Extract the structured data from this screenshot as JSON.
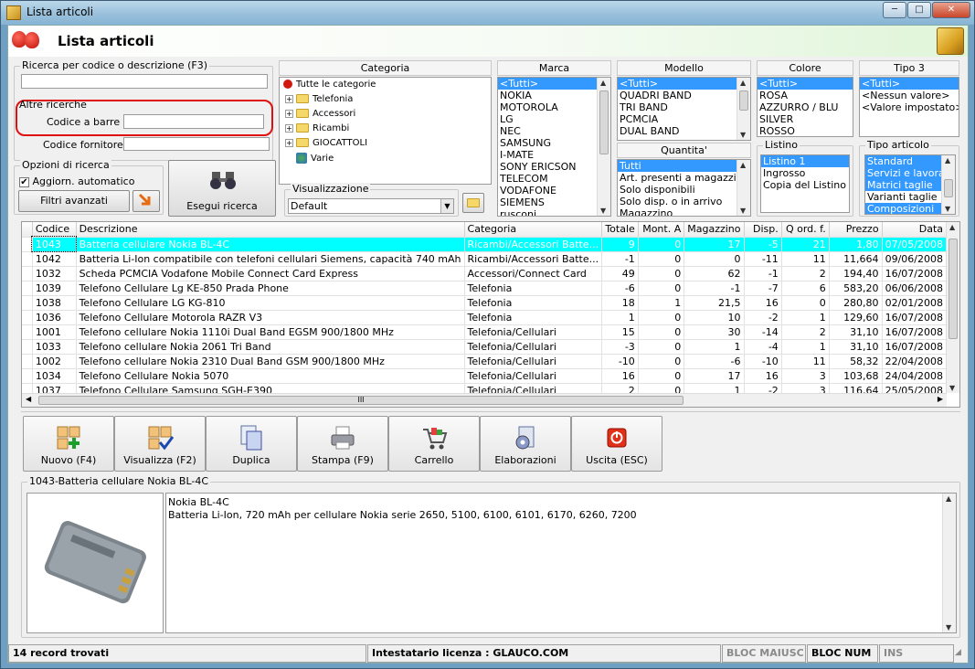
{
  "window": {
    "title": "Lista articoli",
    "min": "─",
    "max": "□",
    "close": "✕"
  },
  "header": {
    "title": "Lista articoli"
  },
  "search": {
    "code_desc_label": "Ricerca per codice o descrizione (F3)",
    "code_desc_value": "",
    "other_label": "Altre ricerche",
    "barcode_label": "Codice a barre :",
    "barcode_value": "",
    "supplier_label": "Codice fornitore :",
    "supplier_value": ""
  },
  "options": {
    "label": "Opzioni di ricerca",
    "auto_update_label": "Aggiorn. automatico",
    "auto_update_checked": true,
    "advanced_filters": "Filtri avanzati",
    "run_search": "Esegui ricerca"
  },
  "category": {
    "title": "Categoria",
    "root": "Tutte le categorie",
    "nodes": [
      "Telefonia",
      "Accessori",
      "Ricambi",
      "GIOCATTOLI",
      "Varie"
    ],
    "view_label": "Visualizzazione",
    "view_value": "Default"
  },
  "brand": {
    "title": "Marca",
    "items": [
      "<Tutti>",
      "NOKIA",
      "MOTOROLA",
      "LG",
      "NEC",
      "SAMSUNG",
      "I-MATE",
      "SONY ERICSON",
      "TELECOM",
      "VODAFONE",
      "SIEMENS",
      "rusconi"
    ]
  },
  "model": {
    "title": "Modello",
    "items": [
      "<Tutti>",
      "QUADRI BAND",
      "TRI BAND",
      "PCMCIA",
      "DUAL BAND"
    ]
  },
  "quantity": {
    "title": "Quantita'",
    "items": [
      "Tutti",
      "Art. presenti a magazzino",
      "Solo disponibili",
      "Solo disp. o in arrivo",
      "Magazzino"
    ]
  },
  "color": {
    "title": "Colore",
    "items": [
      "<Tutti>",
      "ROSA",
      "AZZURRO / BLU",
      "SILVER",
      "ROSSO"
    ]
  },
  "price_list": {
    "title": "Listino",
    "items": [
      "Listino 1",
      "Ingrosso",
      "Copia del Listino 1"
    ]
  },
  "tipo3": {
    "title": "Tipo 3",
    "items": [
      "<Tutti>",
      "<Nessun valore>",
      "<Valore impostato>"
    ]
  },
  "article_type": {
    "title": "Tipo articolo",
    "items": [
      "Standard",
      "Servizi e lavoraz",
      "Matrici taglie",
      "Varianti taglie",
      "Composizioni"
    ]
  },
  "grid": {
    "columns": [
      "Codice",
      "Descrizione",
      "Categoria",
      "Totale",
      "Mont. A",
      "Magazzino",
      "Disp.",
      "Q ord. f.",
      "Prezzo",
      "Data"
    ],
    "rows": [
      [
        "1043",
        "Batteria cellulare Nokia BL-4C",
        "Ricambi/Accessori Batte...",
        "9",
        "0",
        "17",
        "-5",
        "21",
        "1,80",
        "07/05/2008"
      ],
      [
        "1042",
        "Batteria Li-Ion compatibile con telefoni cellulari Siemens, capacità 740 mAh",
        "Ricambi/Accessori Batte...",
        "-1",
        "0",
        "0",
        "-11",
        "11",
        "11,664",
        "09/06/2008"
      ],
      [
        "1032",
        "Scheda PCMCIA Vodafone Mobile Connect Card Express",
        "Accessori/Connect Card",
        "49",
        "0",
        "62",
        "-1",
        "2",
        "194,40",
        "16/07/2008"
      ],
      [
        "1039",
        "Telefono Cellulare Lg KE-850 Prada Phone",
        "Telefonia",
        "-6",
        "0",
        "-1",
        "-7",
        "6",
        "583,20",
        "06/06/2008"
      ],
      [
        "1038",
        "Telefono Cellulare LG KG-810",
        "Telefonia",
        "18",
        "1",
        "21,5",
        "16",
        "0",
        "280,80",
        "02/01/2008"
      ],
      [
        "1036",
        "Telefono Cellulare Motorola RAZR V3",
        "Telefonia",
        "1",
        "0",
        "10",
        "-2",
        "1",
        "129,60",
        "16/07/2008"
      ],
      [
        "1001",
        "Telefono cellulare Nokia 1110i Dual Band EGSM 900/1800 MHz",
        "Telefonia/Cellulari",
        "15",
        "0",
        "30",
        "-14",
        "2",
        "31,10",
        "16/07/2008"
      ],
      [
        "1033",
        "Telefono cellulare Nokia 2061 Tri Band",
        "Telefonia/Cellulari",
        "-3",
        "0",
        "1",
        "-4",
        "1",
        "31,10",
        "16/07/2008"
      ],
      [
        "1002",
        "Telefono cellulare Nokia 2310 Dual Band GSM 900/1800 MHz",
        "Telefonia/Cellulari",
        "-10",
        "0",
        "-6",
        "-10",
        "11",
        "58,32",
        "22/04/2008"
      ],
      [
        "1034",
        "Telefono Cellulare Nokia 5070",
        "Telefonia/Cellulari",
        "16",
        "0",
        "17",
        "16",
        "3",
        "103,68",
        "24/04/2008"
      ],
      [
        "1037",
        "Telefono Cellulare Samsung SGH-E390",
        "Telefonia/Cellulari",
        "2",
        "0",
        "1",
        "-2",
        "3",
        "116,64",
        "25/05/2008"
      ]
    ],
    "hscroll_thumb": "III"
  },
  "toolbar": [
    {
      "label": "Nuovo (F4)",
      "icon": "new-icon"
    },
    {
      "label": "Visualizza (F2)",
      "icon": "view-icon"
    },
    {
      "label": "Duplica",
      "icon": "duplicate-icon"
    },
    {
      "label": "Stampa (F9)",
      "icon": "printer-icon"
    },
    {
      "label": "Carrello",
      "icon": "cart-icon"
    },
    {
      "label": "Elaborazioni",
      "icon": "gear-icon"
    },
    {
      "label": "Uscita (ESC)",
      "icon": "exit-icon"
    }
  ],
  "detail": {
    "title": "1043-Batteria cellulare Nokia BL-4C",
    "line1": "Nokia BL-4C",
    "line2": "Batteria Li-Ion, 720 mAh per cellulare Nokia serie 2650, 5100, 6100, 6101, 6170, 6260, 7200"
  },
  "status": {
    "records": "14 record trovati",
    "license": "Intestatario licenza : GLAUCO.COM",
    "caps": "BLOC MAIUSC",
    "num": "BLOC NUM",
    "ins": "INS"
  },
  "colors": {
    "selection": "#3399ff",
    "row_highlight": "#00ffff",
    "annotation": "#e01010"
  }
}
